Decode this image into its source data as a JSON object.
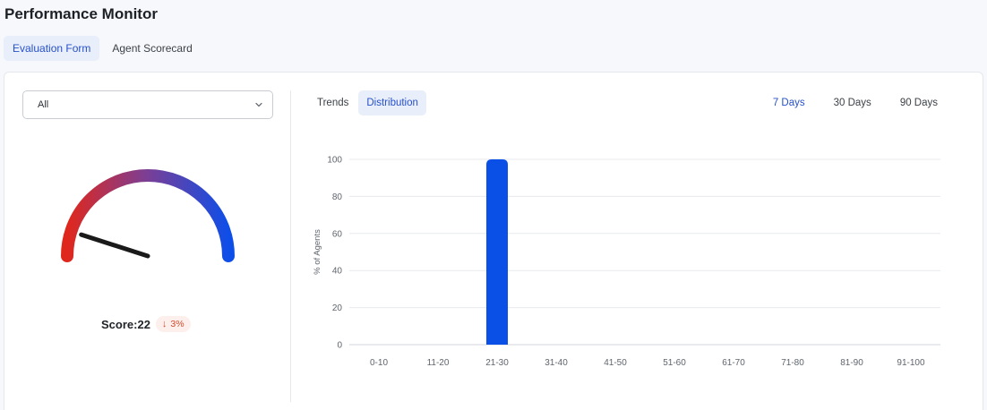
{
  "page": {
    "title": "Performance Monitor"
  },
  "top_tabs": [
    {
      "label": "Evaluation Form",
      "active": true
    },
    {
      "label": "Agent Scorecard",
      "active": false
    }
  ],
  "filter": {
    "selected": "All"
  },
  "gauge": {
    "score_label": "Score:22",
    "score": 22,
    "change": "3%",
    "change_direction": "down",
    "colors": {
      "start": "#e0271c",
      "mid": "#7a3f96",
      "end": "#0e4ee8",
      "needle": "#1a1a1a"
    }
  },
  "chart_tabs": [
    {
      "label": "Trends",
      "active": false
    },
    {
      "label": "Distribution",
      "active": true
    }
  ],
  "range_tabs": [
    {
      "label": "7 Days",
      "active": true
    },
    {
      "label": "30 Days",
      "active": false
    },
    {
      "label": "90 Days",
      "active": false
    }
  ],
  "chart_data": {
    "type": "bar",
    "categories": [
      "0-10",
      "11-20",
      "21-30",
      "31-40",
      "41-50",
      "51-60",
      "61-70",
      "71-80",
      "81-90",
      "91-100"
    ],
    "values": [
      0,
      0,
      100,
      0,
      0,
      0,
      0,
      0,
      0,
      0
    ],
    "ylabel": "% of Agents",
    "xlabel": "",
    "ylim": [
      0,
      100
    ],
    "yticks": [
      0,
      20,
      40,
      60,
      80,
      100
    ],
    "grid": true,
    "bar_color": "#0a4fe6"
  }
}
